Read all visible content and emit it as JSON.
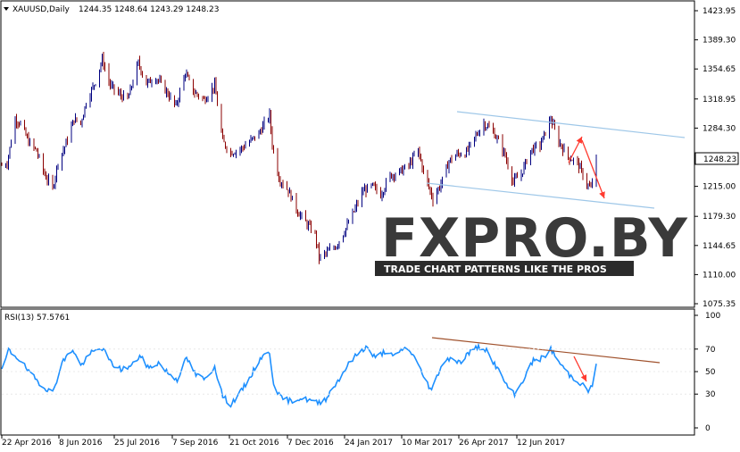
{
  "colors": {
    "bull": "#000080",
    "bear": "#8b0000",
    "rsi": "#1e90ff",
    "channel": "#9ec7e8",
    "rsi_trend": "#a0522d",
    "arrow": "#ff3b30",
    "grid_text": "#000000",
    "tag_bg": "#ffffff",
    "tag_border": "#000000"
  },
  "main": {
    "symbol_label": "XAUUSD,Daily",
    "ohlc_label": "1244.35 1248.64 1243.29 1248.23",
    "current_price_tag": "1248.23"
  },
  "watermark": {
    "logo_text": "FXPRO.BY",
    "tagline": "TRADE CHART PATTERNS LIKE THE PROS"
  },
  "rsi": {
    "label": "RSI(13) 57.5761"
  },
  "chart_data": [
    {
      "type": "candlestick",
      "title": "XAUUSD,Daily",
      "y_ticks": [
        "1423.95",
        "1389.30",
        "1354.65",
        "1318.95",
        "1284.30",
        "1248.23",
        "1215.00",
        "1179.30",
        "1144.65",
        "1110.00",
        "1075.35"
      ],
      "ylim": [
        1075.35,
        1423.95
      ],
      "x_ticks": [
        "22 Apr 2016",
        "8 Jun 2016",
        "25 Jul 2016",
        "7 Sep 2016",
        "21 Oct 2016",
        "7 Dec 2016",
        "24 Jan 2017",
        "10 Mar 2017",
        "26 Apr 2017",
        "12 Jun 2017"
      ],
      "x_start": "2016-04-22",
      "x_end": "2017-07-10",
      "close_path": [
        [
          "2016-04-22",
          1240
        ],
        [
          "2016-04-26",
          1243
        ],
        [
          "2016-05-02",
          1295
        ],
        [
          "2016-05-06",
          1290
        ],
        [
          "2016-05-12",
          1268
        ],
        [
          "2016-05-18",
          1257
        ],
        [
          "2016-05-24",
          1229
        ],
        [
          "2016-05-30",
          1212
        ],
        [
          "2016-06-03",
          1244
        ],
        [
          "2016-06-08",
          1262
        ],
        [
          "2016-06-15",
          1295
        ],
        [
          "2016-06-20",
          1290
        ],
        [
          "2016-06-24",
          1315
        ],
        [
          "2016-07-01",
          1340
        ],
        [
          "2016-07-06",
          1366
        ],
        [
          "2016-07-12",
          1335
        ],
        [
          "2016-07-18",
          1325
        ],
        [
          "2016-07-25",
          1318
        ],
        [
          "2016-08-02",
          1362
        ],
        [
          "2016-08-08",
          1337
        ],
        [
          "2016-08-15",
          1345
        ],
        [
          "2016-08-22",
          1330
        ],
        [
          "2016-08-30",
          1310
        ],
        [
          "2016-09-06",
          1350
        ],
        [
          "2016-09-12",
          1328
        ],
        [
          "2016-09-20",
          1318
        ],
        [
          "2016-09-28",
          1335
        ],
        [
          "2016-10-04",
          1268
        ],
        [
          "2016-10-10",
          1255
        ],
        [
          "2016-10-18",
          1260
        ],
        [
          "2016-10-24",
          1268
        ],
        [
          "2016-10-31",
          1278
        ],
        [
          "2016-11-08",
          1300
        ],
        [
          "2016-11-10",
          1265
        ],
        [
          "2016-11-15",
          1225
        ],
        [
          "2016-11-22",
          1210
        ],
        [
          "2016-11-29",
          1185
        ],
        [
          "2016-12-05",
          1172
        ],
        [
          "2016-12-12",
          1158
        ],
        [
          "2016-12-15",
          1130
        ],
        [
          "2016-12-20",
          1135
        ],
        [
          "2016-12-28",
          1145
        ],
        [
          "2017-01-04",
          1165
        ],
        [
          "2017-01-10",
          1185
        ],
        [
          "2017-01-17",
          1210
        ],
        [
          "2017-01-24",
          1215
        ],
        [
          "2017-01-30",
          1205
        ],
        [
          "2017-02-06",
          1228
        ],
        [
          "2017-02-13",
          1232
        ],
        [
          "2017-02-20",
          1240
        ],
        [
          "2017-02-27",
          1258
        ],
        [
          "2017-03-03",
          1232
        ],
        [
          "2017-03-10",
          1200
        ],
        [
          "2017-03-16",
          1218
        ],
        [
          "2017-03-22",
          1245
        ],
        [
          "2017-03-28",
          1253
        ],
        [
          "2017-04-04",
          1255
        ],
        [
          "2017-04-11",
          1275
        ],
        [
          "2017-04-17",
          1290
        ],
        [
          "2017-04-24",
          1280
        ],
        [
          "2017-05-02",
          1256
        ],
        [
          "2017-05-09",
          1220
        ],
        [
          "2017-05-15",
          1230
        ],
        [
          "2017-05-22",
          1258
        ],
        [
          "2017-05-29",
          1264
        ],
        [
          "2017-06-06",
          1295
        ],
        [
          "2017-06-12",
          1268
        ],
        [
          "2017-06-19",
          1250
        ],
        [
          "2017-06-26",
          1243
        ],
        [
          "2017-07-03",
          1218
        ],
        [
          "2017-07-06",
          1212
        ],
        [
          "2017-07-10",
          1248
        ]
      ]
    },
    {
      "type": "line",
      "title": "RSI(13) 57.5761",
      "y_ticks": [
        "100",
        "70",
        "50",
        "30",
        "0"
      ],
      "ylim": [
        0,
        100
      ],
      "rsi_path": [
        [
          "2016-04-22",
          50
        ],
        [
          "2016-04-27",
          69
        ],
        [
          "2016-05-06",
          60
        ],
        [
          "2016-05-13",
          48
        ],
        [
          "2016-05-23",
          37
        ],
        [
          "2016-05-30",
          31
        ],
        [
          "2016-06-06",
          58
        ],
        [
          "2016-06-14",
          70
        ],
        [
          "2016-06-20",
          55
        ],
        [
          "2016-06-27",
          66
        ],
        [
          "2016-07-06",
          71
        ],
        [
          "2016-07-13",
          57
        ],
        [
          "2016-07-20",
          52
        ],
        [
          "2016-07-28",
          55
        ],
        [
          "2016-08-03",
          64
        ],
        [
          "2016-08-10",
          53
        ],
        [
          "2016-08-17",
          58
        ],
        [
          "2016-08-24",
          49
        ],
        [
          "2016-08-31",
          43
        ],
        [
          "2016-09-07",
          62
        ],
        [
          "2016-09-14",
          47
        ],
        [
          "2016-09-21",
          43
        ],
        [
          "2016-09-28",
          55
        ],
        [
          "2016-10-04",
          28
        ],
        [
          "2016-10-10",
          21
        ],
        [
          "2016-10-17",
          31
        ],
        [
          "2016-10-24",
          44
        ],
        [
          "2016-11-01",
          62
        ],
        [
          "2016-11-08",
          67
        ],
        [
          "2016-11-11",
          40
        ],
        [
          "2016-11-16",
          27
        ],
        [
          "2016-11-23",
          24
        ],
        [
          "2016-11-30",
          26
        ],
        [
          "2016-12-07",
          25
        ],
        [
          "2016-12-14",
          22
        ],
        [
          "2016-12-20",
          26
        ],
        [
          "2016-12-29",
          42
        ],
        [
          "2017-01-05",
          55
        ],
        [
          "2017-01-12",
          65
        ],
        [
          "2017-01-19",
          72
        ],
        [
          "2017-01-26",
          62
        ],
        [
          "2017-02-02",
          68
        ],
        [
          "2017-02-09",
          63
        ],
        [
          "2017-02-16",
          71
        ],
        [
          "2017-02-23",
          66
        ],
        [
          "2017-03-02",
          48
        ],
        [
          "2017-03-09",
          33
        ],
        [
          "2017-03-16",
          55
        ],
        [
          "2017-03-23",
          63
        ],
        [
          "2017-03-30",
          58
        ],
        [
          "2017-04-06",
          67
        ],
        [
          "2017-04-13",
          72
        ],
        [
          "2017-04-18",
          70
        ],
        [
          "2017-04-26",
          55
        ],
        [
          "2017-05-05",
          36
        ],
        [
          "2017-05-10",
          29
        ],
        [
          "2017-05-17",
          44
        ],
        [
          "2017-05-24",
          60
        ],
        [
          "2017-05-31",
          62
        ],
        [
          "2017-06-06",
          70
        ],
        [
          "2017-06-13",
          57
        ],
        [
          "2017-06-20",
          47
        ],
        [
          "2017-06-27",
          41
        ],
        [
          "2017-07-04",
          33
        ],
        [
          "2017-07-07",
          37
        ],
        [
          "2017-07-10",
          58
        ]
      ]
    }
  ]
}
